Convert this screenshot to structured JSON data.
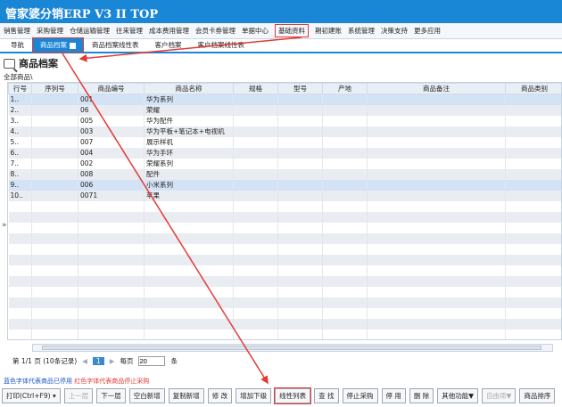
{
  "app_title": "管家婆分销ERP V3 II TOP",
  "menu": [
    "销售管理",
    "采购管理",
    "仓储运输管理",
    "往来管理",
    "成本费用管理",
    "会员卡券管理",
    "单据中心",
    "基础资料",
    "期初建账",
    "系统管理",
    "决策支持",
    "更多应用"
  ],
  "menu_highlight": "基础资料",
  "nav_label": "导航",
  "tabs": [
    "商品档案",
    "商品档案线性表",
    "客户档案",
    "客户档案线性表"
  ],
  "page_title": "商品档案",
  "breadcrumb": "全部商品\\",
  "columns": [
    "行号",
    "序列号",
    "商品编号",
    "商品名称",
    "规格",
    "型号",
    "产地",
    "商品备注",
    "商品类别"
  ],
  "rows": [
    [
      "1..",
      "",
      "001",
      "华为系列",
      "",
      "",
      "",
      "",
      ""
    ],
    [
      "2..",
      "",
      "06",
      "荣耀",
      "",
      "",
      "",
      "",
      ""
    ],
    [
      "3..",
      "",
      "005",
      "华为配件",
      "",
      "",
      "",
      "",
      ""
    ],
    [
      "4..",
      "",
      "003",
      "华为平板+笔记本+电视机",
      "",
      "",
      "",
      "",
      ""
    ],
    [
      "5..",
      "",
      "007",
      "展示样机",
      "",
      "",
      "",
      "",
      ""
    ],
    [
      "6..",
      "",
      "004",
      "华为手环",
      "",
      "",
      "",
      "",
      ""
    ],
    [
      "7..",
      "",
      "002",
      "荣耀系列",
      "",
      "",
      "",
      "",
      ""
    ],
    [
      "8..",
      "",
      "008",
      "配件",
      "",
      "",
      "",
      "",
      ""
    ],
    [
      "9..",
      "",
      "006",
      "小米系列",
      "",
      "",
      "",
      "",
      ""
    ],
    [
      "10..",
      "",
      "0071",
      "苹果",
      "",
      "",
      "",
      "",
      ""
    ]
  ],
  "pager": {
    "info": "第 1/1 页 (10条记录)",
    "current": "1",
    "per_page_label": "每页",
    "per_page": "20",
    "unit": "条",
    "prev": "◀",
    "next": "▶",
    "first": "◀",
    "last": "▶"
  },
  "legend": {
    "blue": "蓝色字体代表商品已停用",
    "red": "红色字体代表商品停止采购"
  },
  "buttons": [
    "打印(Ctrl+F9) ▾",
    "上一层",
    "下一层",
    "空白新增",
    "复制新增",
    "修 改",
    "增加下级",
    "线性列表",
    "查 找",
    "停止采购",
    "停 用",
    "删 除",
    "其他功能▼",
    "自由项▼",
    "商品排序"
  ],
  "colors": {
    "accent": "#1a86d6",
    "highlight": "#e53935"
  }
}
